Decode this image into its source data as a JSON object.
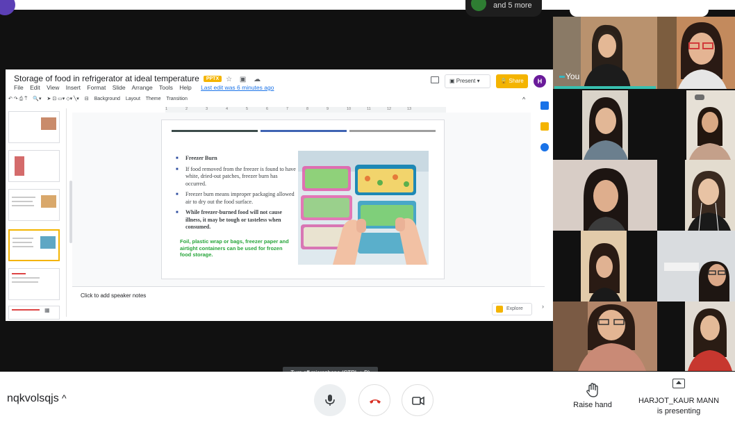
{
  "meet": {
    "top_pill_text": "and 5 more",
    "top_self_label": "You",
    "self_tile_label": "You",
    "meeting_code": "nqkvolsqjs",
    "code_chevron": "^",
    "tooltip": "Turn off microphone (CTRL + D)",
    "raise_hand_label": "Raise hand",
    "presenter_name": "HARJOT_KAUR MANN",
    "presenter_status": "is presenting",
    "colors": {
      "end_call": "#d93025",
      "self_highlight": "#38c0b0"
    }
  },
  "slides_app": {
    "doc_title": "Storage of food in refrigerator at ideal temperature",
    "format_badge": "PPTX",
    "menu": [
      "File",
      "Edit",
      "View",
      "Insert",
      "Format",
      "Slide",
      "Arrange",
      "Tools",
      "Help"
    ],
    "last_edit": "Last edit was 6 minutes ago",
    "present_label": "Present",
    "share_label": "Share",
    "user_initial": "H",
    "toolbar": [
      "Background",
      "Layout",
      "Theme",
      "Transition"
    ],
    "ruler_ticks": [
      "1",
      "2",
      "3",
      "4",
      "5",
      "6",
      "7",
      "8",
      "9",
      "10",
      "11",
      "12",
      "13"
    ],
    "speaker_notes_placeholder": "Click to add speaker notes",
    "explore_label": "Explore",
    "colors": {
      "accent": "#f4b400"
    }
  },
  "slide": {
    "bullets": [
      {
        "text": "Freezer Burn",
        "bold": true
      },
      {
        "text": "If food removed from the freezer is found to have white, dried-out patches, freezer burn has occurred.",
        "bold": false
      },
      {
        "text": "Freezer burn means improper packaging allowed air to dry out the food surface.",
        "bold": false
      },
      {
        "text": "While freezer-burned food will not cause illness, it may be tough or tasteless when consumed.",
        "bold": true
      }
    ],
    "note": "Foil, plastic wrap or bags, freezer paper and airtight containers can be used for frozen food storage.",
    "rule_colors": [
      "#3c4b4a",
      "#3f63b3",
      "#9e9e9e"
    ],
    "note_color": "#27a53a"
  }
}
